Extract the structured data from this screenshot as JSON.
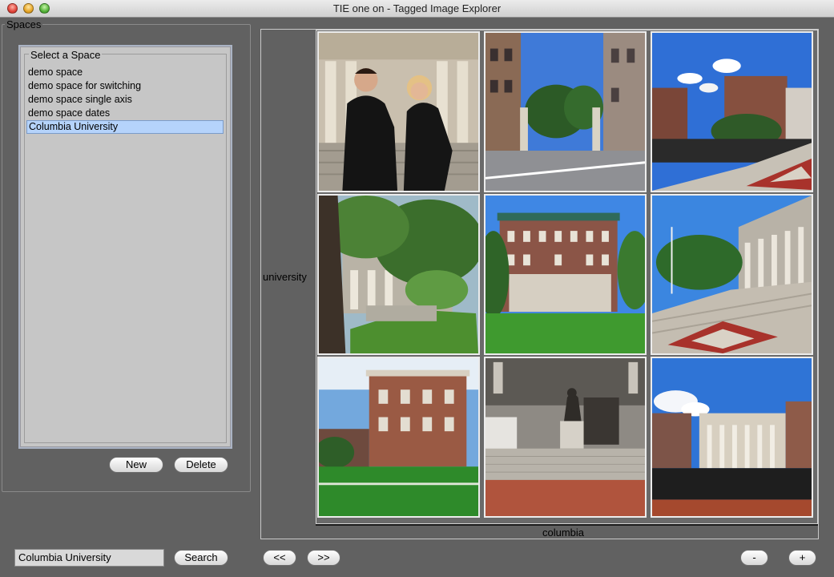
{
  "window": {
    "title": "TIE one on - Tagged Image Explorer"
  },
  "spaces": {
    "legend": "Spaces",
    "list_legend": "Select a Space",
    "items": [
      {
        "label": "demo space",
        "selected": false
      },
      {
        "label": "demo space for switching",
        "selected": false
      },
      {
        "label": "demo space single axis",
        "selected": false
      },
      {
        "label": "demo space dates",
        "selected": false
      },
      {
        "label": "Columbia University",
        "selected": true
      }
    ],
    "new_label": "New",
    "delete_label": "Delete"
  },
  "search": {
    "value": "Columbia University",
    "button_label": "Search"
  },
  "nav": {
    "prev_label": "<<",
    "next_label": ">>",
    "zoom_out_label": "-",
    "zoom_in_label": "+"
  },
  "explorer": {
    "y_axis_label": "university",
    "x_axis_label": "columbia",
    "images": [
      {
        "name": "photo-portrait-columns-icon"
      },
      {
        "name": "photo-campus-gate-icon"
      },
      {
        "name": "photo-plaza-brick-icon"
      },
      {
        "name": "photo-trees-building-icon"
      },
      {
        "name": "photo-brick-building-lawn-icon"
      },
      {
        "name": "photo-library-steps-icon"
      },
      {
        "name": "photo-brick-hall-icon"
      },
      {
        "name": "photo-statue-entrance-icon"
      },
      {
        "name": "photo-library-fence-icon"
      }
    ]
  },
  "colors": {
    "background": "#616161",
    "selection": "#b5d3fb",
    "panel": "#c6c6c6"
  }
}
